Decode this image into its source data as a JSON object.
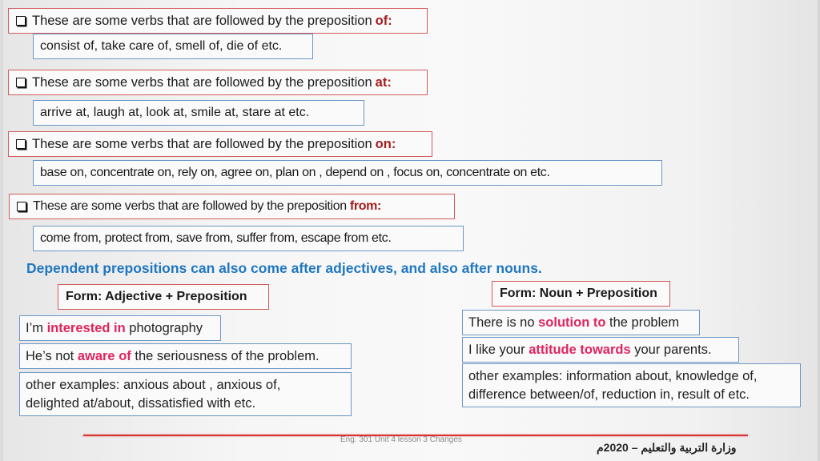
{
  "verb_sections": [
    {
      "heading_text": "These are some verbs that are followed by the preposition",
      "preposition": "of:",
      "examples": "consist of, take care of, smell of, die of etc."
    },
    {
      "heading_text": "These are some verbs that are followed by the preposition",
      "preposition": "at:",
      "examples": "arrive at, laugh at, look at, smile at, stare at etc."
    },
    {
      "heading_text": "These are some verbs that are followed by the preposition",
      "preposition": "on:",
      "examples": "base on,  concentrate on,  rely on,  agree on, plan on , depend on , focus on,  concentrate on etc."
    },
    {
      "heading_text": "These are some verbs that are followed by the preposition",
      "preposition": "from:",
      "examples": "come from, protect from, save from,  suffer from, escape from etc."
    }
  ],
  "subtitle": "Dependent prepositions can also come after adjectives, and also after nouns.",
  "adjective_column": {
    "form_label": "Form: Adjective + Preposition",
    "example1": {
      "before": "I’m ",
      "highlight": "interested in",
      "after": " photography"
    },
    "example2": {
      "before": "He’s not ",
      "highlight": "aware of",
      "after": " the seriousness of the problem."
    },
    "other_line1": "other examples: anxious about , anxious of,",
    "other_line2": "delighted at/about, dissatisfied with etc."
  },
  "noun_column": {
    "form_label": "Form: Noun + Preposition",
    "example1": {
      "before": "There is no ",
      "highlight": "solution to",
      "after": " the problem"
    },
    "example2": {
      "before": "I like your ",
      "highlight": "attitude towards",
      "after": " your parents."
    },
    "other_line1": "other examples: information about, knowledge of,",
    "other_line2": "difference between/of, reduction in, result of etc."
  },
  "footer": {
    "course": "Eng. 301 Unit 4 lesson 3 Changes",
    "ministry": "وزارة التربية والتعليم – 2020م"
  },
  "colors": {
    "heading_border": "#d35a5a",
    "example_border": "#6d97c9",
    "preposition": "#a61c1c",
    "subtitle": "#1f77c2",
    "highlight": "#e0245e",
    "footer_line": "#d93030"
  }
}
